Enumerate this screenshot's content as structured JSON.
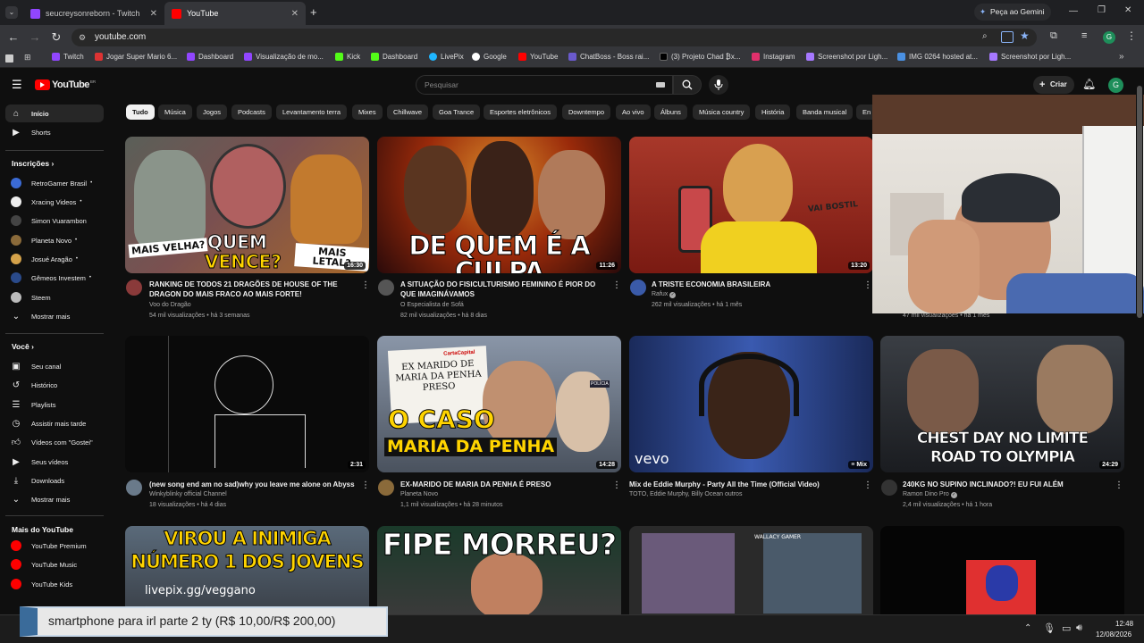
{
  "browser": {
    "tabs": [
      {
        "label": "seucreysonreborn - Twitch",
        "active": false
      },
      {
        "label": "YouTube",
        "active": true
      }
    ],
    "new_tab_label": "+",
    "gemini_label": "Peça ao Gemini",
    "url": "youtube.com",
    "bookmarks": [
      "Twitch",
      "Jogar Super Mario 6...",
      "Dashboard",
      "Visualização de mo...",
      "Kick",
      "Dashboard",
      "LivePix",
      "Google",
      "YouTube",
      "ChatBoss - Boss rai...",
      "(3) Projeto Chad ₿x...",
      "Instagram",
      "Screenshot por Ligh...",
      "IMG 0264 hosted at...",
      "Screenshot por Ligh..."
    ],
    "profile_initial": "G"
  },
  "youtube": {
    "logo_text": "YouTube",
    "logo_region": "BR",
    "search_placeholder": "Pesquisar",
    "create_label": "Criar",
    "avatar_initial": "G",
    "chips": [
      "Tudo",
      "Música",
      "Jogos",
      "Podcasts",
      "Levantamento terra",
      "Mixes",
      "Chillwave",
      "Goa Trance",
      "Esportes eletrônicos",
      "Downtempo",
      "Ao vivo",
      "Álbuns",
      "Música country",
      "História",
      "Banda musical",
      "En"
    ],
    "sidebar": {
      "main": [
        {
          "label": "Início",
          "icon": "home-icon",
          "active": true
        },
        {
          "label": "Shorts",
          "icon": "shorts-icon",
          "active": false
        }
      ],
      "subscriptions_header": "Inscrições",
      "subscriptions": [
        {
          "label": "RetroGamer Brasil",
          "color": "#3b6bd6"
        },
        {
          "label": "Xracing Videos",
          "color": "#eeeeee"
        },
        {
          "label": "Simon Vuarambon",
          "color": "#444444"
        },
        {
          "label": "Planeta Novo",
          "color": "#8a6a3a"
        },
        {
          "label": "Josué Aragão",
          "color": "#d4a24a"
        },
        {
          "label": "Gêmeos Investem",
          "color": "#2a4a8a"
        },
        {
          "label": "Steem",
          "color": "#bbbbbb"
        }
      ],
      "show_more_1": "Mostrar mais",
      "you_header": "Você",
      "you_items": [
        {
          "label": "Seu canal",
          "icon": "channel-icon"
        },
        {
          "label": "Histórico",
          "icon": "history-icon"
        },
        {
          "label": "Playlists",
          "icon": "playlist-icon"
        },
        {
          "label": "Assistir mais tarde",
          "icon": "clock-icon"
        },
        {
          "label": "Vídeos com \"Gostei\"",
          "icon": "like-icon"
        },
        {
          "label": "Seus vídeos",
          "icon": "video-icon"
        },
        {
          "label": "Downloads",
          "icon": "download-icon"
        }
      ],
      "show_more_2": "Mostrar mais",
      "more_header": "Mais do YouTube",
      "more_items": [
        {
          "label": "YouTube Premium"
        },
        {
          "label": "YouTube Music"
        },
        {
          "label": "YouTube Kids"
        }
      ]
    },
    "videos_row1": [
      {
        "title": "RANKING DE TODOS 21 DRAGÕES DE HOUSE OF THE DRAGON DO MAIS FRACO AO MAIS FORTE!",
        "channel": "Voo do Dragão",
        "meta": "54 mil visualizações • há 3 semanas",
        "duration": "16:30",
        "overlay": [
          "MAIS VELHA?",
          "QUEM",
          "VENCE?",
          "MAIS LETAL?"
        ]
      },
      {
        "title": "A SITUAÇÃO DO FISICULTURISMO FEMININO É PIOR DO QUE IMAGINÁVAMOS",
        "channel": "O Especialista de Sofá",
        "meta": "82 mil visualizações • há 8 dias",
        "duration": "11:26",
        "overlay": [
          "DE QUEM É A CULPA"
        ]
      },
      {
        "title": "A TRISTE ECONOMIA BRASILEIRA",
        "channel": "Rafux",
        "meta": "262 mil visualizações • há 1 mês",
        "duration": "13:20",
        "overlay": [
          "VAI BOSTIL"
        ]
      },
      {
        "meta": "47 mil visualizações • há 1 mês"
      }
    ],
    "videos_row2": [
      {
        "title": "(new song end am no sad)why you leave me alone on Abyss",
        "channel": "Winkyblinky official Channel",
        "meta": "18 visualizações • há 4 dias",
        "duration": "2:31"
      },
      {
        "title": "EX-MARIDO DE MARIA DA PENHA É PRESO",
        "channel": "Planeta Novo",
        "meta": "1,1 mil visualizações • há 28 minutos",
        "duration": "14:28",
        "overlay": [
          "CartaCapital",
          "EX MARIDO DE MARIA DA PENHA PRESO",
          "O CASO",
          "MARIA DA PENHA",
          "POLÍCIA"
        ]
      },
      {
        "title": "Mix de Eddie Murphy - Party All the Time (Official Video)",
        "channel": "TOTO, Eddie Murphy, Billy Ocean outros",
        "meta": "",
        "duration": "Mix",
        "overlay": [
          "vevo"
        ]
      },
      {
        "title": "240KG NO SUPINO INCLINADO?! EU FUI ALÉM",
        "channel": "Ramon Dino Pro",
        "meta": "2,4 mil visualizações • há 1 hora",
        "duration": "24:29",
        "overlay": [
          "CHEST DAY NO LIMITE",
          "ROAD TO OLYMPIA"
        ]
      }
    ],
    "videos_row3": [
      {
        "overlay": [
          "VIROU A INIMIGA",
          "NÚMERO 1 DOS JOVENS",
          "livepix.gg/veggano"
        ]
      },
      {
        "overlay": [
          "FIPE MORREU?"
        ]
      },
      {
        "overlay": [
          "WALLACY GAMER"
        ]
      },
      {
        "overlay": []
      }
    ]
  },
  "stream_overlay": {
    "donation_text": "smartphone para irl parte 2 ty (R$ 10,00/R$ 200,00)"
  },
  "taskbar": {
    "time": "12:48",
    "date": "12/08/2026"
  },
  "colors": {
    "yt_red": "#ff0000",
    "bg": "#0f0f0f",
    "chip_bg": "#272727",
    "yellow_text": "#ffd400",
    "red_text": "#ff2a2a"
  }
}
